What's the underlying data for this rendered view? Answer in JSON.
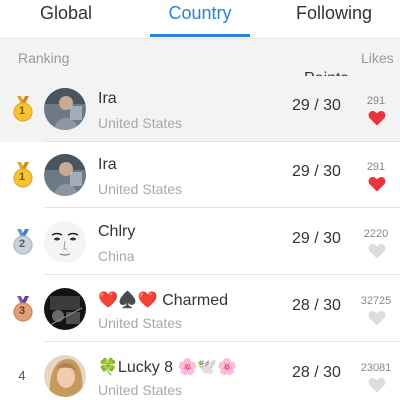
{
  "tabs": [
    {
      "label": "Global",
      "active": false
    },
    {
      "label": "Country",
      "active": true
    },
    {
      "label": "Following",
      "active": false
    }
  ],
  "accent_color": "#2a83d8",
  "header": {
    "ranking": "Ranking",
    "points": "Points",
    "likes": "Likes"
  },
  "rows": [
    {
      "rank": "1",
      "medal": "gold",
      "name": "Ira",
      "country": "United States",
      "points": "29 / 30",
      "likes": "291",
      "liked": true,
      "highlighted": true
    },
    {
      "rank": "1",
      "medal": "gold",
      "name": "Ira",
      "country": "United States",
      "points": "29 / 30",
      "likes": "291",
      "liked": true,
      "highlighted": false
    },
    {
      "rank": "2",
      "medal": "silver",
      "name": "Chlry",
      "country": "China",
      "points": "29 / 30",
      "likes": "2220",
      "liked": false,
      "highlighted": false
    },
    {
      "rank": "3",
      "medal": "bronze",
      "name": "❤️♠️❤️ Charmed",
      "country": "United States",
      "points": "28 / 30",
      "likes": "32725",
      "liked": false,
      "highlighted": false
    },
    {
      "rank": "4",
      "medal": "",
      "name": "🍀Lucky 8 🌸🕊️🌸",
      "country": "United States",
      "points": "28 / 30",
      "likes": "23081",
      "liked": false,
      "highlighted": false
    }
  ]
}
